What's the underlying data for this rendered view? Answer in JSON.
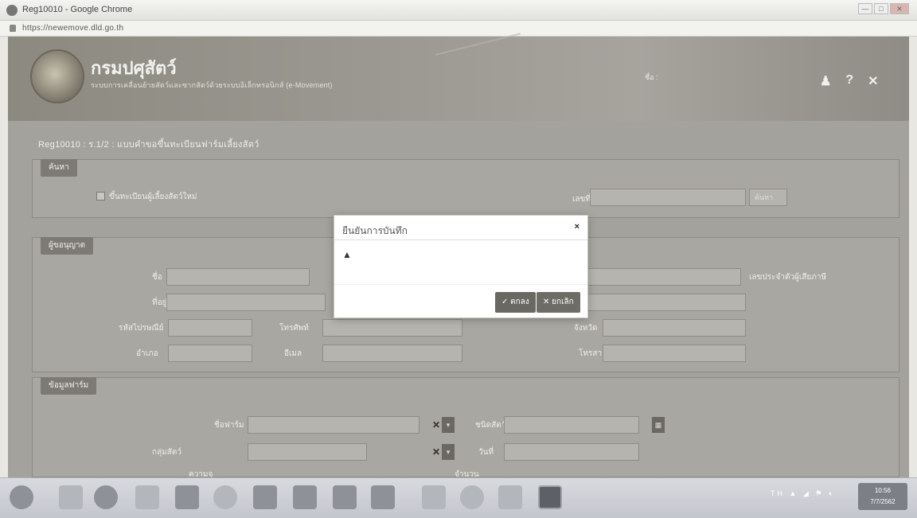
{
  "window": {
    "title": "Reg10010 - Google Chrome",
    "controls": [
      "—",
      "□",
      "✕"
    ]
  },
  "browser": {
    "url": "https://newemove.dld.go.th"
  },
  "header": {
    "brand_name": "กรมปศุสัตว์",
    "brand_sub": "ระบบการเคลื่อนย้ายสัตว์และซากสัตว์ด้วยระบบอิเล็กทรอนิกส์ (e-Movement)",
    "user_line1": "ชื่อ : ",
    "user_line2": ""
  },
  "page": {
    "title": "Reg10010 : ร.1/2 : แบบคำขอขึ้นทะเบียนฟาร์มเลี้ยงสัตว์"
  },
  "search_panel": {
    "heading": "ค้นหา",
    "checkbox_label": "ขึ้นทะเบียนผู้เลี้ยงสัตว์ใหม่",
    "id_label": "เลขที่",
    "search_button": "ค้นหา"
  },
  "owner_panel": {
    "heading": "ผู้ขอนุญาต",
    "name_label": "ชื่อ",
    "name_value": "",
    "address_label": "ที่อยู่",
    "address_value": "",
    "postcode_label": "รหัสไปรษณีย์",
    "postcode_value": "",
    "phone_label": "โทรศัพท์",
    "phone_value": "",
    "fax_label": "โทรสาร",
    "fax_value": "",
    "email_label": "อีเมล",
    "email_value": "",
    "district_label": "อำเภอ",
    "district_value": "",
    "province_label": "จังหวัด",
    "province_value": "",
    "right_label": "เลขประจำตัวผู้เสียภาษี"
  },
  "detail_panel": {
    "heading": "ข้อมูลฟาร์ม",
    "farm_label": "ชื่อฟาร์ม",
    "farm_value": "",
    "type_label": "ชนิดสัตว์",
    "type_value": "",
    "date_label": "วันที่",
    "date_value": "",
    "group_label": "กลุ่มสัตว์",
    "group_value": "",
    "capacity_label": "ความจุ",
    "capacity_value": "",
    "count_label": "จำนวน",
    "count_value": ""
  },
  "modal": {
    "title": "ยืนยันการบันทึก",
    "close_glyph": "×",
    "warn_glyph": "▲",
    "message": "",
    "ok_label": "✓ ตกลง",
    "cancel_label": "✕ ยกเลิก"
  },
  "taskbar": {
    "clock_time": "10:56",
    "clock_date": "7/7/2562"
  }
}
